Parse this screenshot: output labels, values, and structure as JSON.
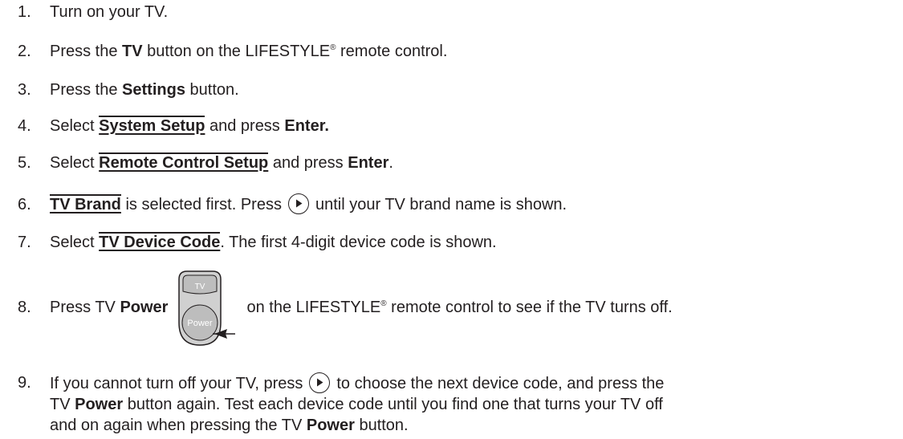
{
  "steps": [
    {
      "num": "1.",
      "text": "Turn on your TV."
    },
    {
      "num": "2.",
      "t1": "Press the ",
      "b1": "TV",
      "t2": " button on the LIFESTYLE",
      "reg": "®",
      "t3": " remote control."
    },
    {
      "num": "3.",
      "t1": "Press the ",
      "b1": "Settings",
      "t2": " button."
    },
    {
      "num": "4.",
      "t1": "Select ",
      "menu": "System Setup",
      "t2": " and press ",
      "b1": "Enter."
    },
    {
      "num": "5.",
      "t1": "Select ",
      "menu": "Remote Control Setup",
      "t2": " and press ",
      "b1": "Enter",
      "t3": "."
    },
    {
      "num": "6.",
      "menu": "TV Brand",
      "t1": " is selected first. Press",
      "t2": "until your TV brand name is shown."
    },
    {
      "num": "7.",
      "t1": "Select ",
      "menu": "TV Device Code",
      "t2": ". The first 4-digit device code is shown."
    },
    {
      "num": "8.",
      "t1": "Press TV ",
      "b1": "Power",
      "t2": "on the LIFESTYLE",
      "reg": "®",
      "t3": " remote control to see if the TV turns off."
    },
    {
      "num": "9.",
      "t1": "If you cannot turn off your TV, press",
      "t2": "to choose the next device code, and press the",
      "line2_t1": "TV ",
      "line2_b1": "Power",
      "line2_t2": " button again. Test each device code until you find one that turns your TV off",
      "line3_t1": "and on again when pressing the TV ",
      "line3_b1": "Power",
      "line3_t2": " button."
    }
  ],
  "icons": {
    "play": "play-button-icon",
    "remote": "remote-tv-power-buttons-icon",
    "remote_tv_label": "TV",
    "remote_power_label": "Power"
  },
  "colors": {
    "text": "#231f20",
    "button_fill": "#c9c9c9"
  }
}
